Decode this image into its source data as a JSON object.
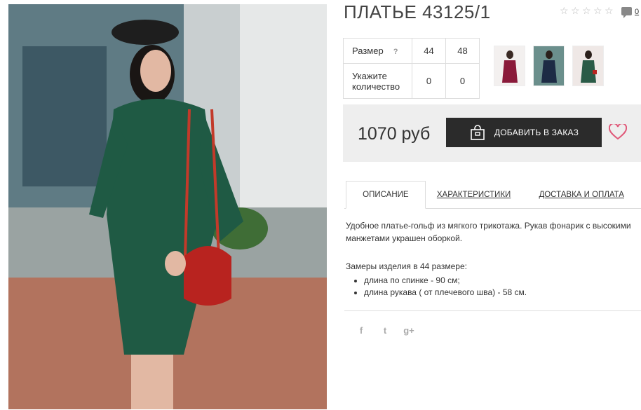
{
  "product": {
    "title": "ПЛАТЬЕ 43125/1",
    "rating_stars": 5,
    "comments_count": "0",
    "image_alt": "Woman in green dress with red bag"
  },
  "sizes_table": {
    "size_label": "Размер",
    "help_mark": "?",
    "sizes": [
      "44",
      "48"
    ],
    "qty_label": "Укажите количество",
    "quantities": [
      "0",
      "0"
    ]
  },
  "thumbnails": [
    "burgundy-dress-thumb",
    "navy-dress-thumb",
    "green-dress-thumb"
  ],
  "buy": {
    "price": "1070 руб",
    "add_label": "ДОБАВИТЬ В ЗАКАЗ"
  },
  "tabs": [
    {
      "label": "ОПИСАНИЕ",
      "active": true
    },
    {
      "label": "ХАРАКТЕРИСТИКИ",
      "active": false
    },
    {
      "label": "ДОСТАВКА И ОПЛАТА",
      "active": false
    }
  ],
  "description": {
    "paragraph": "Удобное платье-гольф из мягкого трикотажа. Рукав фонарик с высокими манжетами украшен оборкой.",
    "measures_title": "Замеры изделия в 44 размере:",
    "measures": [
      "длина по спинке - 90 см;",
      "длина рукава ( от плечевого шва) - 58 см."
    ]
  },
  "social": {
    "facebook": "f",
    "twitter": "t",
    "googleplus": "g+"
  },
  "colors": {
    "button_bg": "#2b2b2b",
    "heart": "#e05a7a",
    "buybar": "#eeeeee"
  }
}
